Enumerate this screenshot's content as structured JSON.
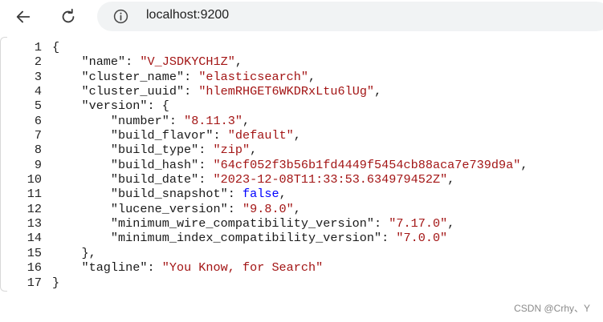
{
  "browser": {
    "url": "localhost:9200"
  },
  "icons": {
    "back": "arrow-left-icon",
    "reload": "reload-icon",
    "info": "info-icon"
  },
  "code_lines": [
    {
      "n": "1",
      "indent": "",
      "parts": [
        {
          "t": "p",
          "v": "{"
        }
      ]
    },
    {
      "n": "2",
      "indent": "    ",
      "parts": [
        {
          "t": "k",
          "v": "\"name\""
        },
        {
          "t": "p",
          "v": ": "
        },
        {
          "t": "s",
          "v": "\"V_JSDKYCH1Z\""
        },
        {
          "t": "p",
          "v": ","
        }
      ]
    },
    {
      "n": "3",
      "indent": "    ",
      "parts": [
        {
          "t": "k",
          "v": "\"cluster_name\""
        },
        {
          "t": "p",
          "v": ": "
        },
        {
          "t": "s",
          "v": "\"elasticsearch\""
        },
        {
          "t": "p",
          "v": ","
        }
      ]
    },
    {
      "n": "4",
      "indent": "    ",
      "parts": [
        {
          "t": "k",
          "v": "\"cluster_uuid\""
        },
        {
          "t": "p",
          "v": ": "
        },
        {
          "t": "s",
          "v": "\"hlemRHGET6WKDRxLtu6lUg\""
        },
        {
          "t": "p",
          "v": ","
        }
      ]
    },
    {
      "n": "5",
      "indent": "    ",
      "parts": [
        {
          "t": "k",
          "v": "\"version\""
        },
        {
          "t": "p",
          "v": ": {"
        }
      ]
    },
    {
      "n": "6",
      "indent": "        ",
      "parts": [
        {
          "t": "k",
          "v": "\"number\""
        },
        {
          "t": "p",
          "v": ": "
        },
        {
          "t": "s",
          "v": "\"8.11.3\""
        },
        {
          "t": "p",
          "v": ","
        }
      ]
    },
    {
      "n": "7",
      "indent": "        ",
      "parts": [
        {
          "t": "k",
          "v": "\"build_flavor\""
        },
        {
          "t": "p",
          "v": ": "
        },
        {
          "t": "s",
          "v": "\"default\""
        },
        {
          "t": "p",
          "v": ","
        }
      ]
    },
    {
      "n": "8",
      "indent": "        ",
      "parts": [
        {
          "t": "k",
          "v": "\"build_type\""
        },
        {
          "t": "p",
          "v": ": "
        },
        {
          "t": "s",
          "v": "\"zip\""
        },
        {
          "t": "p",
          "v": ","
        }
      ]
    },
    {
      "n": "9",
      "indent": "        ",
      "parts": [
        {
          "t": "k",
          "v": "\"build_hash\""
        },
        {
          "t": "p",
          "v": ": "
        },
        {
          "t": "s",
          "v": "\"64cf052f3b56b1fd4449f5454cb88aca7e739d9a\""
        },
        {
          "t": "p",
          "v": ","
        }
      ]
    },
    {
      "n": "10",
      "indent": "        ",
      "parts": [
        {
          "t": "k",
          "v": "\"build_date\""
        },
        {
          "t": "p",
          "v": ": "
        },
        {
          "t": "s",
          "v": "\"2023-12-08T11:33:53.634979452Z\""
        },
        {
          "t": "p",
          "v": ","
        }
      ]
    },
    {
      "n": "11",
      "indent": "        ",
      "parts": [
        {
          "t": "k",
          "v": "\"build_snapshot\""
        },
        {
          "t": "p",
          "v": ": "
        },
        {
          "t": "b",
          "v": "false"
        },
        {
          "t": "p",
          "v": ","
        }
      ]
    },
    {
      "n": "12",
      "indent": "        ",
      "parts": [
        {
          "t": "k",
          "v": "\"lucene_version\""
        },
        {
          "t": "p",
          "v": ": "
        },
        {
          "t": "s",
          "v": "\"9.8.0\""
        },
        {
          "t": "p",
          "v": ","
        }
      ]
    },
    {
      "n": "13",
      "indent": "        ",
      "parts": [
        {
          "t": "k",
          "v": "\"minimum_wire_compatibility_version\""
        },
        {
          "t": "p",
          "v": ": "
        },
        {
          "t": "s",
          "v": "\"7.17.0\""
        },
        {
          "t": "p",
          "v": ","
        }
      ]
    },
    {
      "n": "14",
      "indent": "        ",
      "parts": [
        {
          "t": "k",
          "v": "\"minimum_index_compatibility_version\""
        },
        {
          "t": "p",
          "v": ": "
        },
        {
          "t": "s",
          "v": "\"7.0.0\""
        }
      ]
    },
    {
      "n": "15",
      "indent": "    ",
      "parts": [
        {
          "t": "p",
          "v": "},"
        }
      ]
    },
    {
      "n": "16",
      "indent": "    ",
      "parts": [
        {
          "t": "k",
          "v": "\"tagline\""
        },
        {
          "t": "p",
          "v": ": "
        },
        {
          "t": "s",
          "v": "\"You Know, for Search\""
        }
      ]
    },
    {
      "n": "17",
      "indent": "",
      "parts": [
        {
          "t": "p",
          "v": "}"
        }
      ]
    }
  ],
  "watermark": "CSDN @Crhy、Y"
}
